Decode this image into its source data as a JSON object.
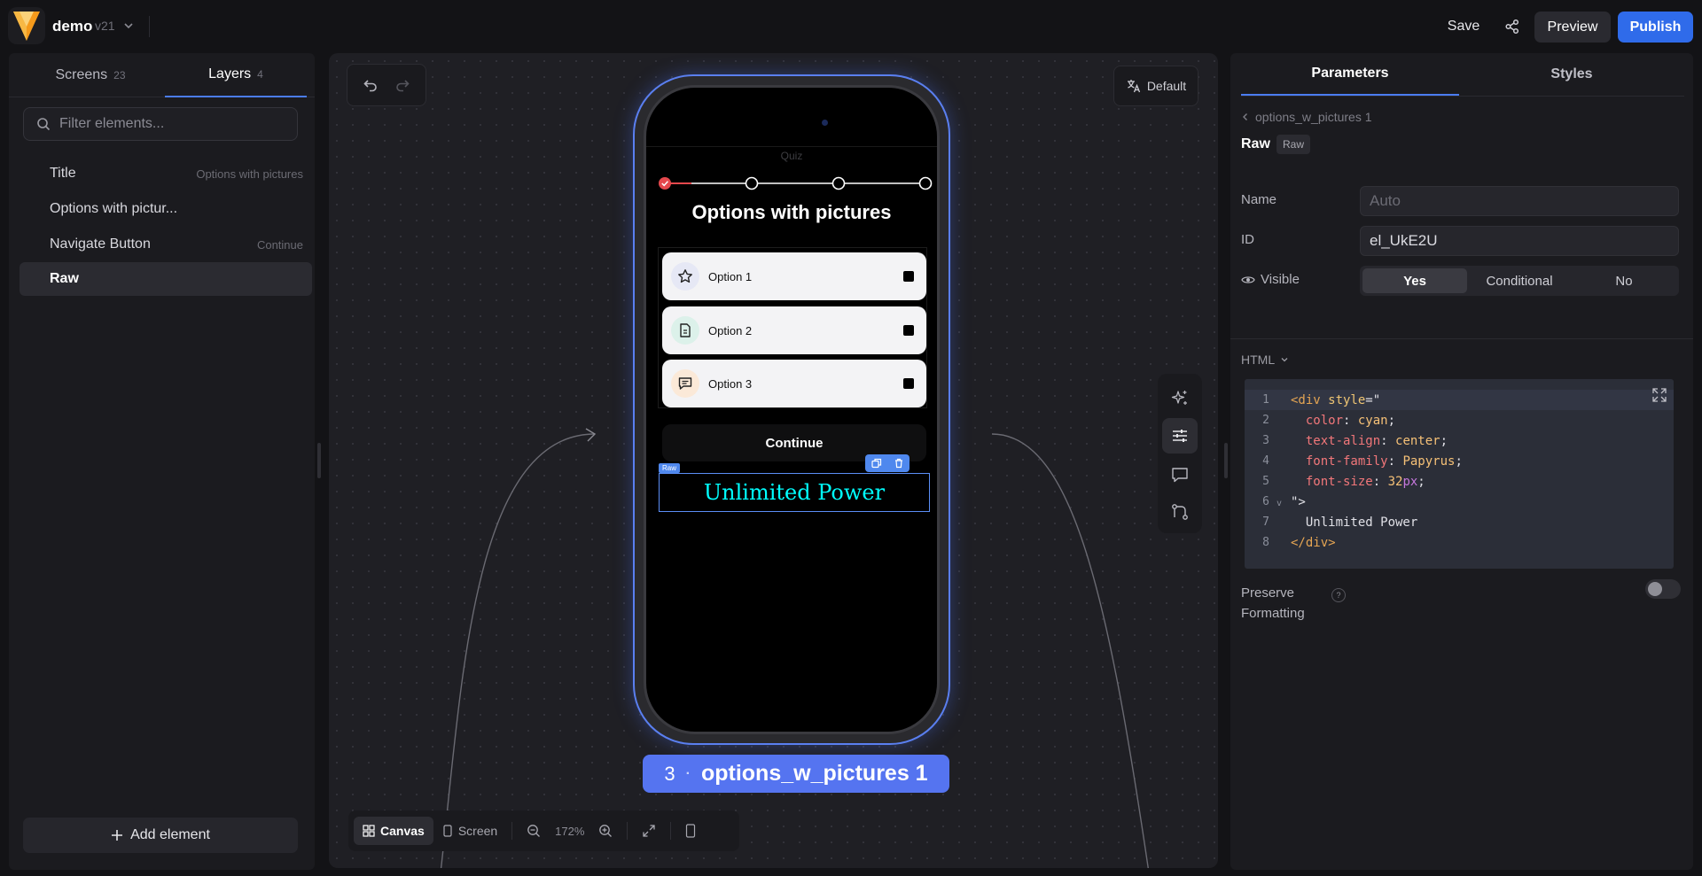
{
  "app": {
    "project_name": "demo",
    "version": "v21",
    "accent": "#2f6bea"
  },
  "topbar": {
    "save_label": "Save",
    "preview_label": "Preview",
    "publish_label": "Publish"
  },
  "left_panel": {
    "tabs": [
      {
        "label": "Screens",
        "count": "23"
      },
      {
        "label": "Layers",
        "count": "4"
      }
    ],
    "filter_placeholder": "Filter elements...",
    "layers": [
      {
        "name": "Title",
        "sub": "Options with pictures"
      },
      {
        "name": "Options with pictur...",
        "sub": ""
      },
      {
        "name": "Navigate Button",
        "sub": "Continue"
      },
      {
        "name": "Raw",
        "sub": ""
      }
    ],
    "add_element_label": "Add element"
  },
  "canvas": {
    "language_label": "Default",
    "screen_number": "3",
    "screen_name": "options_w_pictures 1",
    "zoom": "172%",
    "view_modes": [
      "Canvas",
      "Screen"
    ],
    "phone": {
      "header_label": "Quiz",
      "title": "Options with pictures",
      "options": [
        {
          "label": "Option 1",
          "icon": "star-icon"
        },
        {
          "label": "Option 2",
          "icon": "document-icon"
        },
        {
          "label": "Option 3",
          "icon": "message-icon"
        }
      ],
      "continue_label": "Continue",
      "raw_tag": "Raw",
      "raw_text": "Unlimited Power",
      "progress": {
        "steps": 4,
        "current": 1,
        "color": "#e5484d"
      }
    }
  },
  "right_panel": {
    "tabs": [
      "Parameters",
      "Styles"
    ],
    "breadcrumb": "options_w_pictures 1",
    "element_title": "Raw",
    "element_badge": "Raw",
    "name_label": "Name",
    "name_placeholder": "Auto",
    "id_label": "ID",
    "id_value": "el_UkE2U",
    "visible_label": "Visible",
    "visible_options": [
      "Yes",
      "Conditional",
      "No"
    ],
    "visible_selected": "Yes",
    "html_label": "HTML",
    "code_lines": [
      "1",
      "2",
      "3",
      "4",
      "5",
      "6",
      "7",
      "8"
    ],
    "code": {
      "l1_tag": "<div",
      "l1_attr": " style",
      "l1_rest": "=\"",
      "l2_prop": "color",
      "l2_val": "cyan",
      "l3_prop": "text-align",
      "l3_val": "center",
      "l4_prop": "font-family",
      "l4_val": "Papyrus",
      "l5_prop": "font-size",
      "l5_num": "32",
      "l5_unit": "px",
      "l6": "\">",
      "l7": "Unlimited Power",
      "l8": "</div>"
    },
    "preserve_label_1": "Preserve",
    "preserve_label_2": "Formatting",
    "help_glyph": "?"
  }
}
